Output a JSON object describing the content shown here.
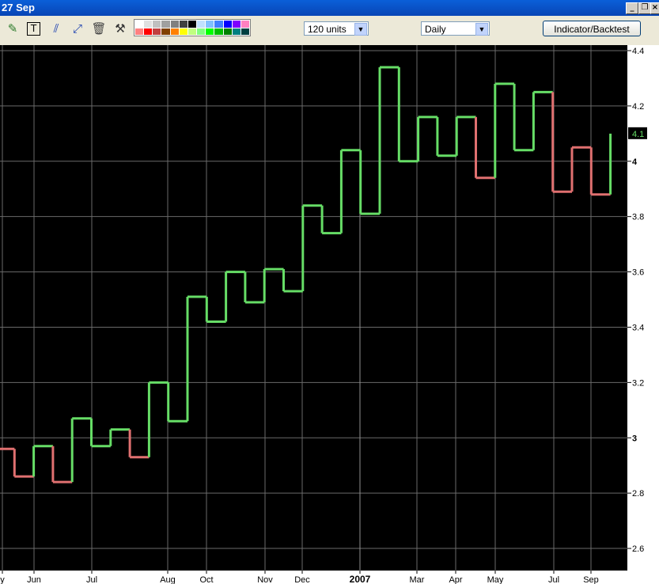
{
  "window": {
    "title": "27 Sep"
  },
  "toolbar": {
    "units_label": "120 units",
    "period_label": "Daily",
    "indicator_button": "Indicator/Backtest",
    "palette_colors": [
      "#ffffff",
      "#e0e0e0",
      "#c0c0c0",
      "#a0a0a0",
      "#808080",
      "#404040",
      "#000000",
      "#c0e0ff",
      "#80c0ff",
      "#4080ff",
      "#0000ff",
      "#8000ff",
      "#ff80c0",
      "#ff8080",
      "#ff0000",
      "#c04040",
      "#804000",
      "#ff8000",
      "#ffff00",
      "#c0ff80",
      "#80ff80",
      "#00ff00",
      "#00c000",
      "#008000",
      "#008080",
      "#004040"
    ]
  },
  "chart_data": {
    "type": "line",
    "style": "step",
    "ylim": [
      2.52,
      4.42
    ],
    "y_ticks": [
      2.6,
      2.8,
      3,
      3.2,
      3.4,
      3.6,
      3.8,
      4,
      4.2,
      4.4
    ],
    "x_labels": [
      "y",
      "Jun",
      "Jul",
      "Aug",
      "Oct",
      "Nov",
      "Dec",
      "2007",
      "Mar",
      "Apr",
      "May",
      "Jul",
      "Sep"
    ],
    "last_value_label": "4.1",
    "colors": {
      "up": "#66dd66",
      "down": "#e07070",
      "grid": "#6a6a6a",
      "background": "#000000"
    },
    "steps": [
      {
        "value": 2.96,
        "dir": "down"
      },
      {
        "value": 2.86,
        "dir": "down"
      },
      {
        "value": 2.97,
        "dir": "up"
      },
      {
        "value": 2.84,
        "dir": "down"
      },
      {
        "value": 3.07,
        "dir": "up"
      },
      {
        "value": 2.97,
        "dir": "up"
      },
      {
        "value": 3.03,
        "dir": "up"
      },
      {
        "value": 2.93,
        "dir": "down"
      },
      {
        "value": 3.2,
        "dir": "up"
      },
      {
        "value": 3.06,
        "dir": "up"
      },
      {
        "value": 3.51,
        "dir": "up"
      },
      {
        "value": 3.42,
        "dir": "up"
      },
      {
        "value": 3.6,
        "dir": "up"
      },
      {
        "value": 3.49,
        "dir": "up"
      },
      {
        "value": 3.61,
        "dir": "up"
      },
      {
        "value": 3.53,
        "dir": "up"
      },
      {
        "value": 3.84,
        "dir": "up"
      },
      {
        "value": 3.74,
        "dir": "up"
      },
      {
        "value": 4.04,
        "dir": "up"
      },
      {
        "value": 3.81,
        "dir": "up"
      },
      {
        "value": 4.34,
        "dir": "up"
      },
      {
        "value": 4.0,
        "dir": "up"
      },
      {
        "value": 4.16,
        "dir": "up"
      },
      {
        "value": 4.02,
        "dir": "up"
      },
      {
        "value": 4.16,
        "dir": "up"
      },
      {
        "value": 3.94,
        "dir": "down"
      },
      {
        "value": 4.28,
        "dir": "up"
      },
      {
        "value": 4.04,
        "dir": "up"
      },
      {
        "value": 4.25,
        "dir": "up"
      },
      {
        "value": 3.89,
        "dir": "down"
      },
      {
        "value": 4.05,
        "dir": "down"
      },
      {
        "value": 3.88,
        "dir": "down"
      },
      {
        "value": 4.1,
        "dir": "up"
      }
    ]
  }
}
